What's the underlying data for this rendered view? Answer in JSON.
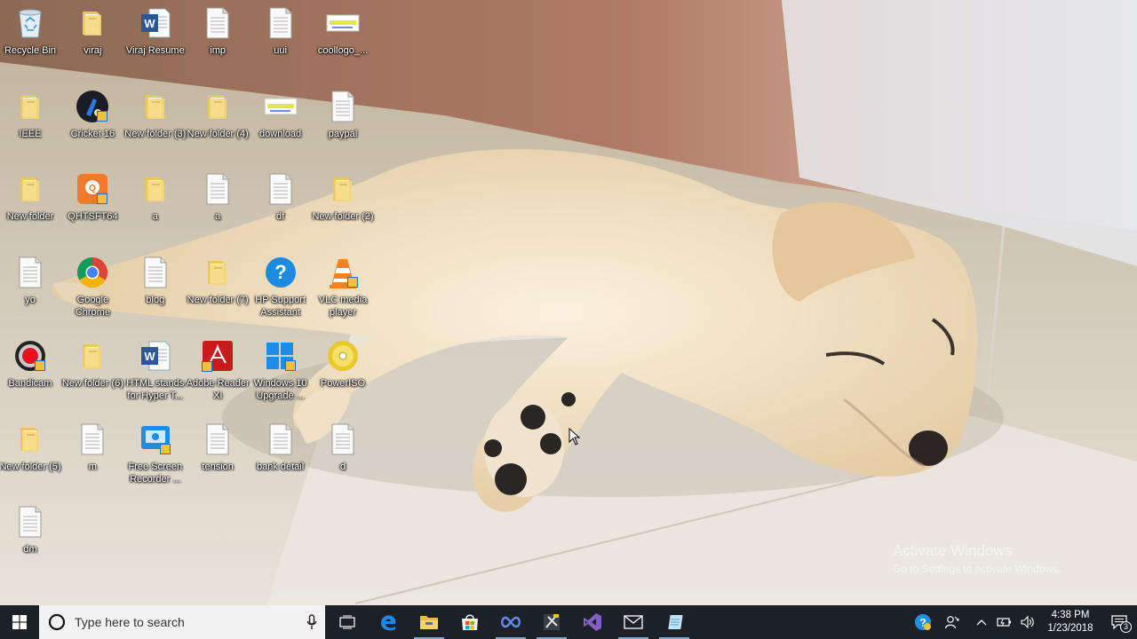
{
  "desktop": {
    "icons": [
      {
        "label": "Recycle Bin",
        "icon": "recycle-bin-icon"
      },
      {
        "label": "viraj",
        "icon": "folder-icon"
      },
      {
        "label": "Viraj Resume",
        "icon": "word-document-icon"
      },
      {
        "label": "imp",
        "icon": "text-file-icon"
      },
      {
        "label": "uui",
        "icon": "text-file-icon"
      },
      {
        "label": "coollogo_...",
        "icon": "image-file-icon"
      },
      {
        "label": "IEEE",
        "icon": "folder-icon"
      },
      {
        "label": "Cricket 16",
        "icon": "cricket-game-icon"
      },
      {
        "label": "New folder (3)",
        "icon": "folder-icon"
      },
      {
        "label": "New folder (4)",
        "icon": "folder-icon"
      },
      {
        "label": "download",
        "icon": "image-file-icon"
      },
      {
        "label": "paypal",
        "icon": "text-file-icon"
      },
      {
        "label": "New folder",
        "icon": "folder-icon"
      },
      {
        "label": "QHTSFT64",
        "icon": "qht-app-icon"
      },
      {
        "label": "a",
        "icon": "folder-icon"
      },
      {
        "label": "a",
        "icon": "text-file-icon"
      },
      {
        "label": "df",
        "icon": "text-file-icon"
      },
      {
        "label": "New folder (2)",
        "icon": "folder-icon"
      },
      {
        "label": "yo",
        "icon": "text-file-icon"
      },
      {
        "label": "Google Chrome",
        "icon": "chrome-icon"
      },
      {
        "label": "blog",
        "icon": "text-file-icon"
      },
      {
        "label": "New folder (7)",
        "icon": "folder-icon"
      },
      {
        "label": "HP Support Assistant",
        "icon": "hp-support-icon"
      },
      {
        "label": "VLC media player",
        "icon": "vlc-icon"
      },
      {
        "label": "Bandicam",
        "icon": "bandicam-icon"
      },
      {
        "label": "New folder (6)",
        "icon": "folder-icon"
      },
      {
        "label": "HTML stands for Hyper T...",
        "icon": "word-document-icon"
      },
      {
        "label": "Adobe Reader XI",
        "icon": "adobe-reader-icon"
      },
      {
        "label": "Windows 10 Upgrade ...",
        "icon": "windows-upgrade-icon"
      },
      {
        "label": "PowerISO",
        "icon": "poweriso-icon"
      },
      {
        "label": "New folder (5)",
        "icon": "folder-icon"
      },
      {
        "label": "m",
        "icon": "text-file-icon"
      },
      {
        "label": "Free Screen Recorder ...",
        "icon": "screen-recorder-icon"
      },
      {
        "label": "tension",
        "icon": "text-file-icon"
      },
      {
        "label": "bank detail",
        "icon": "text-file-icon"
      },
      {
        "label": "d",
        "icon": "text-file-icon"
      },
      {
        "label": "dm",
        "icon": "text-file-icon"
      }
    ]
  },
  "watermark": {
    "line1": "Activate Windows",
    "line2": "Go to Settings to activate Windows."
  },
  "taskbar": {
    "search_placeholder": "Type here to search",
    "pinned": [
      {
        "name": "task-view",
        "icon": "task-view-icon"
      },
      {
        "name": "edge",
        "icon": "edge-icon"
      },
      {
        "name": "file-explorer",
        "icon": "file-explorer-icon"
      },
      {
        "name": "store",
        "icon": "store-icon"
      },
      {
        "name": "infinity-app",
        "icon": "infinity-app-icon"
      },
      {
        "name": "tools-app",
        "icon": "tools-app-icon"
      },
      {
        "name": "visual-studio",
        "icon": "visual-studio-icon"
      },
      {
        "name": "mail",
        "icon": "mail-icon"
      },
      {
        "name": "notepad-app",
        "icon": "notepad-app-icon"
      }
    ],
    "clock": {
      "time": "4:38 PM",
      "date": "1/23/2018"
    },
    "notification_count": "3"
  },
  "colors": {
    "taskbar_bg": "#1c2128",
    "accent": "#7aa7d6"
  }
}
